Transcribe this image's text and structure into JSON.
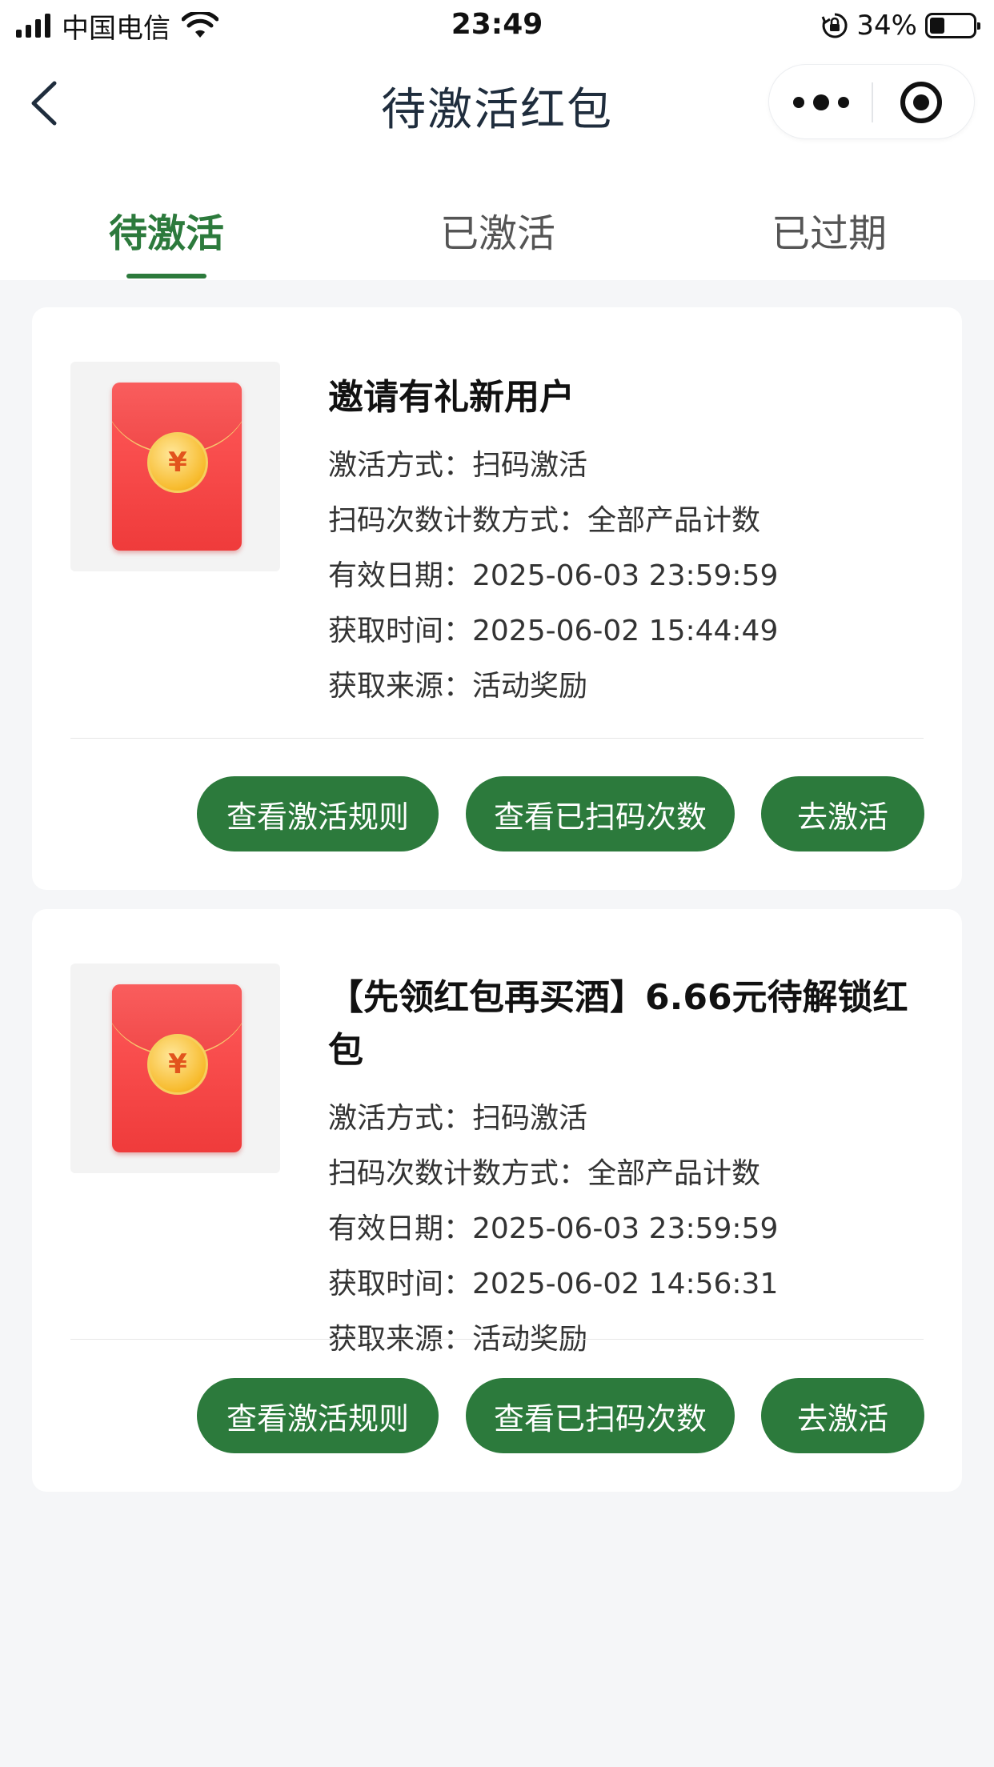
{
  "status_bar": {
    "carrier": "中国电信",
    "time": "23:49",
    "battery": "34%",
    "battery_level": 0.34,
    "icons": [
      "signal-icon",
      "wifi-icon",
      "rotation-lock-icon",
      "battery-icon"
    ]
  },
  "nav": {
    "title": "待激活红包",
    "back_icon": "chevron-left-icon",
    "more_icon": "more-dots-icon",
    "close_icon": "target-circle-icon"
  },
  "tabs": [
    {
      "label": "待激活",
      "active": true
    },
    {
      "label": "已激活",
      "active": false
    },
    {
      "label": "已过期",
      "active": false
    }
  ],
  "colors": {
    "accent": "#2c7a3c",
    "envelope": "#ef3b3b",
    "background": "#f5f6f8"
  },
  "cards": [
    {
      "image_icon": "red-envelope-icon",
      "coin_symbol": "¥",
      "title": "邀请有礼新用户",
      "rows": [
        "激活方式：扫码激活",
        "扫码次数计数方式：全部产品计数",
        "有效日期：2025-06-03 23:59:59",
        "获取时间：2025-06-02 15:44:49",
        "获取来源：活动奖励"
      ],
      "buttons": [
        "查看激活规则",
        "查看已扫码次数",
        "去激活"
      ]
    },
    {
      "image_icon": "red-envelope-icon",
      "coin_symbol": "¥",
      "title": "【先领红包再买酒】6.66元待解锁红包",
      "rows": [
        "激活方式：扫码激活",
        "扫码次数计数方式：全部产品计数",
        "有效日期：2025-06-03 23:59:59",
        "获取时间：2025-06-02 14:56:31",
        "获取来源：活动奖励"
      ],
      "buttons": [
        "查看激活规则",
        "查看已扫码次数",
        "去激活"
      ]
    }
  ]
}
